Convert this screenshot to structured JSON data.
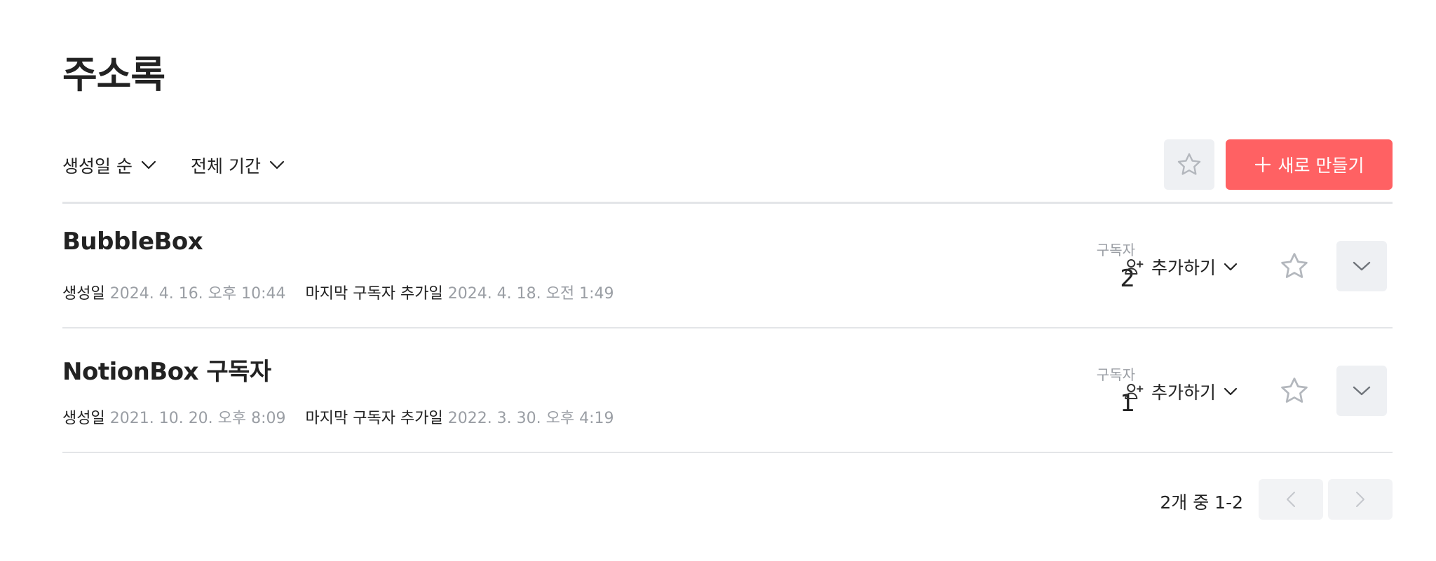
{
  "header": {
    "title": "주소록"
  },
  "toolbar": {
    "sort_label": "생성일 순",
    "period_label": "전체 기간",
    "favorite_filter_icon": "star-outline-icon",
    "create_label": "새로 만들기",
    "create_icon": "plus-icon"
  },
  "colors": {
    "accent": "#ff6163",
    "muted_text": "#9a9ea4",
    "button_bg": "#eef0f3",
    "divider": "#e3e5e8"
  },
  "list": {
    "rows": [
      {
        "name": "BubbleBox",
        "created_label": "생성일",
        "created_value": "2024. 4. 16. 오후 10:44",
        "last_added_label": "마지막 구독자 추가일",
        "last_added_value": "2024. 4. 18. 오전 1:49",
        "subscribers_label": "구독자",
        "subscribers_count": "2",
        "add_label": "추가하기"
      },
      {
        "name": "NotionBox 구독자",
        "created_label": "생성일",
        "created_value": "2021. 10. 20. 오후 8:09",
        "last_added_label": "마지막 구독자 추가일",
        "last_added_value": "2022. 3. 30. 오후 4:19",
        "subscribers_label": "구독자",
        "subscribers_count": "1",
        "add_label": "추가하기"
      }
    ]
  },
  "pagination": {
    "info": "2개 중 1-2"
  }
}
